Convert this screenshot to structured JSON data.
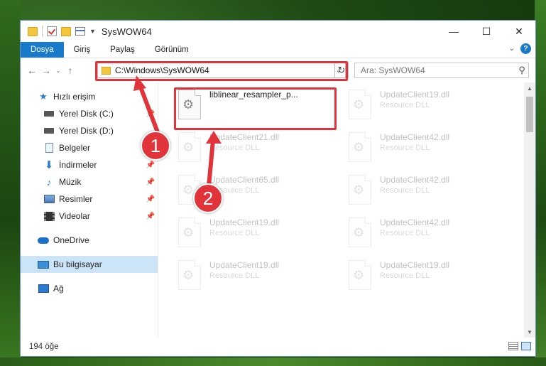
{
  "window": {
    "title": "SysWOW64",
    "controls": {
      "minimize": "—",
      "maximize": "☐",
      "close": "✕"
    }
  },
  "ribbon": {
    "tabs": [
      {
        "label": "Dosya",
        "active": true
      },
      {
        "label": "Giriş",
        "active": false
      },
      {
        "label": "Paylaş",
        "active": false
      },
      {
        "label": "Görünüm",
        "active": false
      }
    ],
    "help_label": "?"
  },
  "nav": {
    "address": "C:\\Windows\\SysWOW64",
    "search_placeholder": "Ara: SysWOW64"
  },
  "sidebar": {
    "items": [
      {
        "label": "Hızlı erişim",
        "icon": "star-icon",
        "pinned": false
      },
      {
        "label": "Yerel Disk (C:)",
        "icon": "drive-icon",
        "pinned": true
      },
      {
        "label": "Yerel Disk (D:)",
        "icon": "drive-icon",
        "pinned": false
      },
      {
        "label": "Belgeler",
        "icon": "document-icon",
        "pinned": true
      },
      {
        "label": "İndirmeler",
        "icon": "download-icon",
        "pinned": true
      },
      {
        "label": "Müzik",
        "icon": "music-icon",
        "pinned": true
      },
      {
        "label": "Resimler",
        "icon": "pictures-icon",
        "pinned": true
      },
      {
        "label": "Videolar",
        "icon": "video-icon",
        "pinned": true
      },
      {
        "label": "OneDrive",
        "icon": "cloud-icon",
        "pinned": false
      },
      {
        "label": "Bu bilgisayar",
        "icon": "computer-icon",
        "pinned": false,
        "selected": true
      },
      {
        "label": "Ağ",
        "icon": "network-icon",
        "pinned": false
      }
    ]
  },
  "files": [
    {
      "name": "liblinear_resampler_p...",
      "type": "",
      "highlighted": true
    },
    {
      "name": "UpdateClient19.dll",
      "type": "Resource DLL"
    },
    {
      "name": "UpdateClient21.dll",
      "type": "Resource DLL"
    },
    {
      "name": "UpdateClient42.dll",
      "type": "Resource DLL"
    },
    {
      "name": "UpdateClient65.dll",
      "type": "Resource DLL"
    },
    {
      "name": "UpdateClient42.dll",
      "type": "Resource DLL"
    },
    {
      "name": "UpdateClient19.dll",
      "type": "Resource DLL"
    },
    {
      "name": "UpdateClient42.dll",
      "type": "Resource DLL"
    },
    {
      "name": "UpdateClient19.dll",
      "type": "Resource DLL"
    },
    {
      "name": "UpdateClient19.dll",
      "type": "Resource DLL"
    }
  ],
  "status": {
    "item_count": "194 öğe"
  },
  "annotations": {
    "badge1": "1",
    "badge2": "2",
    "color": "#e0343a"
  }
}
